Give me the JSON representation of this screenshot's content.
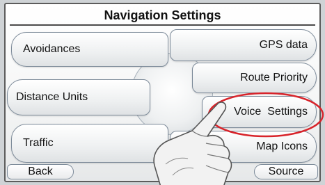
{
  "screen": {
    "title": "Navigation Settings"
  },
  "menu": {
    "avoidances": "Avoidances",
    "distance_units": "Distance Units",
    "traffic": "Traffic",
    "gps_data": "GPS data",
    "route_priority": "Route Priority",
    "voice_settings": "Voice  Settings",
    "map_icons": "Map Icons"
  },
  "footer": {
    "back": "Back",
    "source": "Source"
  },
  "colors": {
    "highlight": "#d8232a"
  }
}
